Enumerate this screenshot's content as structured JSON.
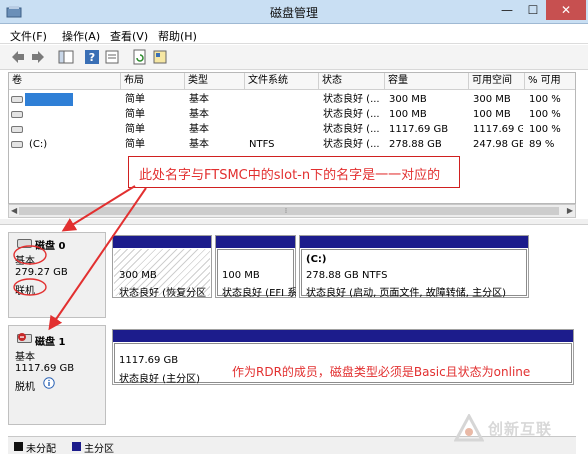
{
  "window": {
    "title": "磁盘管理",
    "minimize": "—",
    "maximize": "☐",
    "close": "✕"
  },
  "menu": [
    "文件(F)",
    "操作(A)",
    "查看(V)",
    "帮助(H)"
  ],
  "toolbar_icons": [
    "back-arrow-icon",
    "forward-arrow-icon",
    "console-tree-icon",
    "help-icon",
    "properties-icon",
    "refresh-icon",
    "export-icon"
  ],
  "volume_list": {
    "columns": [
      "卷",
      "布局",
      "类型",
      "文件系统",
      "状态",
      "容量",
      "可用空间",
      "% 可用"
    ],
    "rows": [
      {
        "volume": "",
        "layout": "简单",
        "type": "基本",
        "fs": "",
        "status": "状态良好 (...",
        "capacity": "300 MB",
        "free": "300 MB",
        "pct": "100 %"
      },
      {
        "volume": "",
        "layout": "简单",
        "type": "基本",
        "fs": "",
        "status": "状态良好 (...",
        "capacity": "100 MB",
        "free": "100 MB",
        "pct": "100 %"
      },
      {
        "volume": "",
        "layout": "简单",
        "type": "基本",
        "fs": "",
        "status": "状态良好 (...",
        "capacity": "1117.69 GB",
        "free": "1117.69 GB",
        "pct": "100 %"
      },
      {
        "volume": "(C:)",
        "layout": "简单",
        "type": "基本",
        "fs": "NTFS",
        "status": "状态良好 (...",
        "capacity": "278.88 GB",
        "free": "247.98 GB",
        "pct": "89 %"
      }
    ]
  },
  "disks": [
    {
      "name": "磁盘 0",
      "type": "基本",
      "size": "279.27 GB",
      "state": "联机",
      "partitions": [
        {
          "size": "300 MB",
          "status": "状态良好 (恢复分区"
        },
        {
          "size": "100 MB",
          "status": "状态良好 (EFI 系"
        },
        {
          "name": "(C:)",
          "size": "278.88 GB NTFS",
          "status": "状态良好 (启动, 页面文件, 故障转储, 主分区)"
        }
      ]
    },
    {
      "name": "磁盘 1",
      "type": "基本",
      "size": "1117.69 GB",
      "state": "脱机",
      "state_icon": "info-icon",
      "partitions": [
        {
          "size": "1117.69 GB",
          "status": "状态良好 (主分区)"
        }
      ]
    }
  ],
  "legend": [
    {
      "label": "未分配",
      "color": "#111111"
    },
    {
      "label": "主分区",
      "color": "#1c1c8c"
    }
  ],
  "annotations": {
    "callout": "此处名字与FTSMC中的slot-n下的名字是一一对应的",
    "note": "作为RDR的成员，磁盘类型必须是Basic且状态为online"
  },
  "watermark": "创新互联",
  "colors": {
    "accent": "#e23030",
    "partition_bar": "#1c1c8c",
    "selection": "#2f7fd6"
  }
}
